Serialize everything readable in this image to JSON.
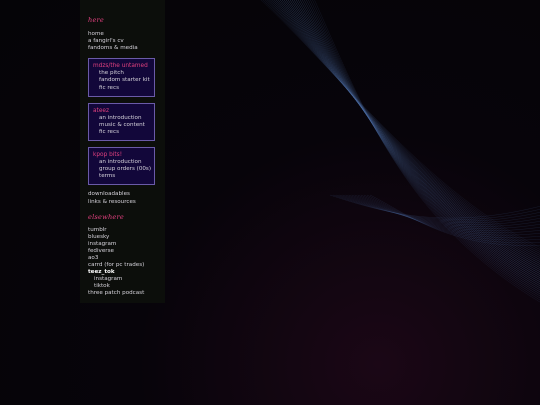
{
  "sections": {
    "here": "here",
    "elsewhere": "elsewhere"
  },
  "nav": {
    "home": "home",
    "fangirl_cv": "a fangirl's cv",
    "fandoms_media": "fandoms & media",
    "downloadables": "downloadables",
    "links_resources": "links & resources"
  },
  "boxes": [
    {
      "title": "mdzs/the untamed",
      "items": [
        "the pitch",
        "fandom starter kit",
        "fic recs"
      ]
    },
    {
      "title": "ateez",
      "items": [
        "an introduction",
        "music & content",
        "fic recs"
      ]
    },
    {
      "title": "kpop bits!",
      "items": [
        "an introduction",
        "group orders (00s)",
        "terms"
      ]
    }
  ],
  "elsewhere": {
    "tumblr": "tumblr",
    "bluesky": "bluesky",
    "instagram": "instagram",
    "fediverse": "fediverse",
    "ao3": "ao3",
    "carrd": "carrd (for pc trades)",
    "teez_tok": "teez_tok",
    "teez_instagram": "instagram",
    "teez_tiktok": "tiktok",
    "podcast": "three patch podcast"
  },
  "colors": {
    "accent": "#e0407e",
    "box_bg": "#12073a",
    "box_border": "#6a5aa8",
    "sidebar_bg": "#0c0e0b",
    "text": "#d7d4dc",
    "wave": "#4a6aa0"
  },
  "background": {
    "decoration": "wave-lines"
  }
}
